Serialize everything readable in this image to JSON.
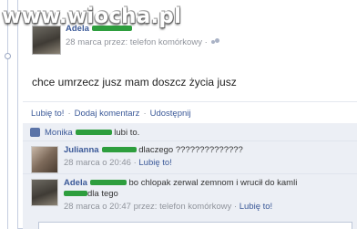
{
  "watermark": {
    "text": "www.wiocha.pl"
  },
  "post": {
    "author": "Adela",
    "meta": "28 marca przez: telefon komórkowy ·",
    "status_text": "chce umrzecz jusz mam doszcz życia jusz",
    "privacy_icon": "friends-icon"
  },
  "actions": {
    "like": "Lubię to!",
    "comment": "Dodaj komentarz",
    "share": "Udostępnij",
    "separator": "·"
  },
  "likes": {
    "name": "Monika",
    "suffix": "lubi to.",
    "icon": "thumbs-up-icon"
  },
  "comments": [
    {
      "author": "Julianna",
      "text": "dlaczego ??????????????",
      "meta": "28 marca o 20:46 ·",
      "like": "Lubię to!"
    },
    {
      "author": "Adela",
      "text": "bo chlopak zerwal zemnom i wrucił do kamli",
      "text2": "dla tego",
      "meta": "28 marca o 20:47 przez: telefon komórkowy ·",
      "like": "Lubię to!"
    }
  ],
  "colors": {
    "link": "#3b5998",
    "censor": "#2e9e3e",
    "ufi_background": "#eceff5"
  }
}
